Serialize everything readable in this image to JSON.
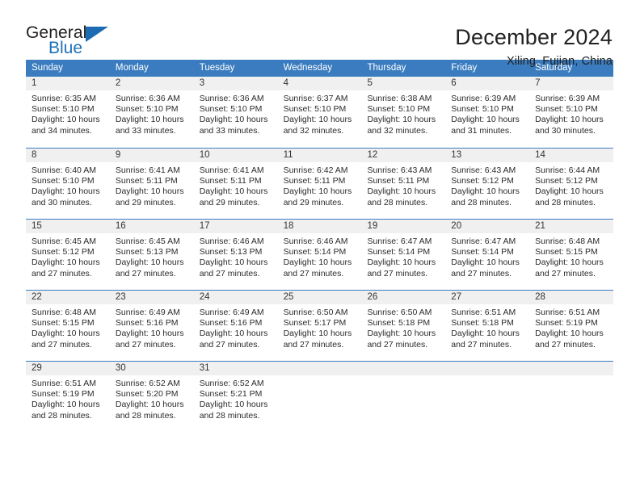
{
  "brand": {
    "name_top": "General",
    "name_bottom": "Blue",
    "triangle_color": "#1b6cb3",
    "blue_text_color": "#1d71b8"
  },
  "header": {
    "title": "December 2024",
    "subtitle": "Xiling, Fujian, China",
    "header_bg": "#3a7cbf",
    "band_bg": "#f0f0f0"
  },
  "weekdays": [
    "Sunday",
    "Monday",
    "Tuesday",
    "Wednesday",
    "Thursday",
    "Friday",
    "Saturday"
  ],
  "weeks": [
    [
      {
        "day": "1",
        "sunrise": "Sunrise: 6:35 AM",
        "sunset": "Sunset: 5:10 PM",
        "daylight1": "Daylight: 10 hours",
        "daylight2": "and 34 minutes."
      },
      {
        "day": "2",
        "sunrise": "Sunrise: 6:36 AM",
        "sunset": "Sunset: 5:10 PM",
        "daylight1": "Daylight: 10 hours",
        "daylight2": "and 33 minutes."
      },
      {
        "day": "3",
        "sunrise": "Sunrise: 6:36 AM",
        "sunset": "Sunset: 5:10 PM",
        "daylight1": "Daylight: 10 hours",
        "daylight2": "and 33 minutes."
      },
      {
        "day": "4",
        "sunrise": "Sunrise: 6:37 AM",
        "sunset": "Sunset: 5:10 PM",
        "daylight1": "Daylight: 10 hours",
        "daylight2": "and 32 minutes."
      },
      {
        "day": "5",
        "sunrise": "Sunrise: 6:38 AM",
        "sunset": "Sunset: 5:10 PM",
        "daylight1": "Daylight: 10 hours",
        "daylight2": "and 32 minutes."
      },
      {
        "day": "6",
        "sunrise": "Sunrise: 6:39 AM",
        "sunset": "Sunset: 5:10 PM",
        "daylight1": "Daylight: 10 hours",
        "daylight2": "and 31 minutes."
      },
      {
        "day": "7",
        "sunrise": "Sunrise: 6:39 AM",
        "sunset": "Sunset: 5:10 PM",
        "daylight1": "Daylight: 10 hours",
        "daylight2": "and 30 minutes."
      }
    ],
    [
      {
        "day": "8",
        "sunrise": "Sunrise: 6:40 AM",
        "sunset": "Sunset: 5:10 PM",
        "daylight1": "Daylight: 10 hours",
        "daylight2": "and 30 minutes."
      },
      {
        "day": "9",
        "sunrise": "Sunrise: 6:41 AM",
        "sunset": "Sunset: 5:11 PM",
        "daylight1": "Daylight: 10 hours",
        "daylight2": "and 29 minutes."
      },
      {
        "day": "10",
        "sunrise": "Sunrise: 6:41 AM",
        "sunset": "Sunset: 5:11 PM",
        "daylight1": "Daylight: 10 hours",
        "daylight2": "and 29 minutes."
      },
      {
        "day": "11",
        "sunrise": "Sunrise: 6:42 AM",
        "sunset": "Sunset: 5:11 PM",
        "daylight1": "Daylight: 10 hours",
        "daylight2": "and 29 minutes."
      },
      {
        "day": "12",
        "sunrise": "Sunrise: 6:43 AM",
        "sunset": "Sunset: 5:11 PM",
        "daylight1": "Daylight: 10 hours",
        "daylight2": "and 28 minutes."
      },
      {
        "day": "13",
        "sunrise": "Sunrise: 6:43 AM",
        "sunset": "Sunset: 5:12 PM",
        "daylight1": "Daylight: 10 hours",
        "daylight2": "and 28 minutes."
      },
      {
        "day": "14",
        "sunrise": "Sunrise: 6:44 AM",
        "sunset": "Sunset: 5:12 PM",
        "daylight1": "Daylight: 10 hours",
        "daylight2": "and 28 minutes."
      }
    ],
    [
      {
        "day": "15",
        "sunrise": "Sunrise: 6:45 AM",
        "sunset": "Sunset: 5:12 PM",
        "daylight1": "Daylight: 10 hours",
        "daylight2": "and 27 minutes."
      },
      {
        "day": "16",
        "sunrise": "Sunrise: 6:45 AM",
        "sunset": "Sunset: 5:13 PM",
        "daylight1": "Daylight: 10 hours",
        "daylight2": "and 27 minutes."
      },
      {
        "day": "17",
        "sunrise": "Sunrise: 6:46 AM",
        "sunset": "Sunset: 5:13 PM",
        "daylight1": "Daylight: 10 hours",
        "daylight2": "and 27 minutes."
      },
      {
        "day": "18",
        "sunrise": "Sunrise: 6:46 AM",
        "sunset": "Sunset: 5:14 PM",
        "daylight1": "Daylight: 10 hours",
        "daylight2": "and 27 minutes."
      },
      {
        "day": "19",
        "sunrise": "Sunrise: 6:47 AM",
        "sunset": "Sunset: 5:14 PM",
        "daylight1": "Daylight: 10 hours",
        "daylight2": "and 27 minutes."
      },
      {
        "day": "20",
        "sunrise": "Sunrise: 6:47 AM",
        "sunset": "Sunset: 5:14 PM",
        "daylight1": "Daylight: 10 hours",
        "daylight2": "and 27 minutes."
      },
      {
        "day": "21",
        "sunrise": "Sunrise: 6:48 AM",
        "sunset": "Sunset: 5:15 PM",
        "daylight1": "Daylight: 10 hours",
        "daylight2": "and 27 minutes."
      }
    ],
    [
      {
        "day": "22",
        "sunrise": "Sunrise: 6:48 AM",
        "sunset": "Sunset: 5:15 PM",
        "daylight1": "Daylight: 10 hours",
        "daylight2": "and 27 minutes."
      },
      {
        "day": "23",
        "sunrise": "Sunrise: 6:49 AM",
        "sunset": "Sunset: 5:16 PM",
        "daylight1": "Daylight: 10 hours",
        "daylight2": "and 27 minutes."
      },
      {
        "day": "24",
        "sunrise": "Sunrise: 6:49 AM",
        "sunset": "Sunset: 5:16 PM",
        "daylight1": "Daylight: 10 hours",
        "daylight2": "and 27 minutes."
      },
      {
        "day": "25",
        "sunrise": "Sunrise: 6:50 AM",
        "sunset": "Sunset: 5:17 PM",
        "daylight1": "Daylight: 10 hours",
        "daylight2": "and 27 minutes."
      },
      {
        "day": "26",
        "sunrise": "Sunrise: 6:50 AM",
        "sunset": "Sunset: 5:18 PM",
        "daylight1": "Daylight: 10 hours",
        "daylight2": "and 27 minutes."
      },
      {
        "day": "27",
        "sunrise": "Sunrise: 6:51 AM",
        "sunset": "Sunset: 5:18 PM",
        "daylight1": "Daylight: 10 hours",
        "daylight2": "and 27 minutes."
      },
      {
        "day": "28",
        "sunrise": "Sunrise: 6:51 AM",
        "sunset": "Sunset: 5:19 PM",
        "daylight1": "Daylight: 10 hours",
        "daylight2": "and 27 minutes."
      }
    ],
    [
      {
        "day": "29",
        "sunrise": "Sunrise: 6:51 AM",
        "sunset": "Sunset: 5:19 PM",
        "daylight1": "Daylight: 10 hours",
        "daylight2": "and 28 minutes."
      },
      {
        "day": "30",
        "sunrise": "Sunrise: 6:52 AM",
        "sunset": "Sunset: 5:20 PM",
        "daylight1": "Daylight: 10 hours",
        "daylight2": "and 28 minutes."
      },
      {
        "day": "31",
        "sunrise": "Sunrise: 6:52 AM",
        "sunset": "Sunset: 5:21 PM",
        "daylight1": "Daylight: 10 hours",
        "daylight2": "and 28 minutes."
      },
      {
        "day": "",
        "sunrise": "",
        "sunset": "",
        "daylight1": "",
        "daylight2": ""
      },
      {
        "day": "",
        "sunrise": "",
        "sunset": "",
        "daylight1": "",
        "daylight2": ""
      },
      {
        "day": "",
        "sunrise": "",
        "sunset": "",
        "daylight1": "",
        "daylight2": ""
      },
      {
        "day": "",
        "sunrise": "",
        "sunset": "",
        "daylight1": "",
        "daylight2": ""
      }
    ]
  ]
}
